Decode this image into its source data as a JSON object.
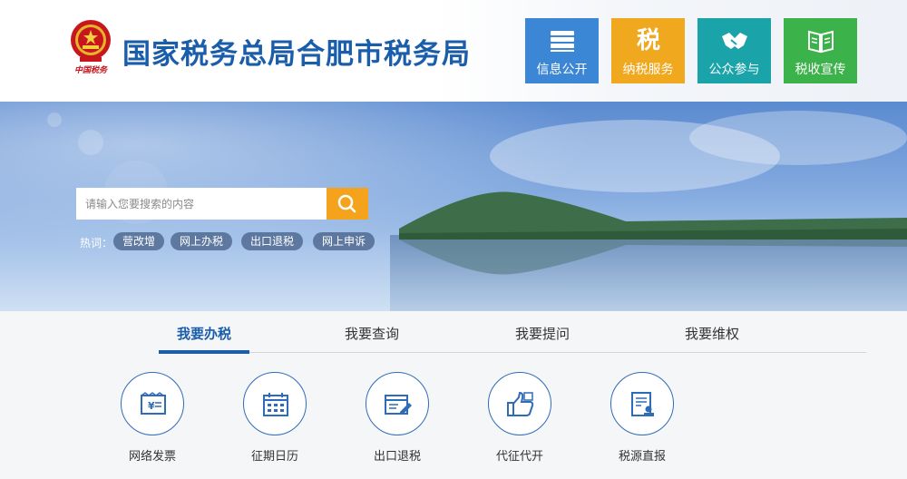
{
  "header": {
    "emblem_caption": "中国税务",
    "site_title": "国家税务总局合肥市税务局",
    "nav": [
      {
        "label": "信息公开",
        "icon": "books-icon",
        "color": "#3c86d6"
      },
      {
        "label": "纳税服务",
        "icon": "tax-character-icon",
        "glyph": "税",
        "color": "#f0a81e"
      },
      {
        "label": "公众参与",
        "icon": "handshake-icon",
        "color": "#1aa3a8"
      },
      {
        "label": "税收宣传",
        "icon": "open-book-icon",
        "color": "#3bb24a"
      }
    ]
  },
  "search": {
    "placeholder": "请输入您要搜索的内容",
    "button_icon": "search-icon",
    "hot_label": "热词：",
    "hot_terms": [
      "营改增",
      "网上办税",
      "出口退税",
      "网上申诉"
    ]
  },
  "tabs": [
    "我要办税",
    "我要查询",
    "我要提问",
    "我要维权"
  ],
  "active_tab": "我要办税",
  "services": [
    {
      "label": "网络发票",
      "icon": "invoice-icon"
    },
    {
      "label": "征期日历",
      "icon": "calendar-icon"
    },
    {
      "label": "出口退税",
      "icon": "form-edit-icon"
    },
    {
      "label": "代征代开",
      "icon": "thumbs-up-icon"
    },
    {
      "label": "税源直报",
      "icon": "report-stamp-icon"
    }
  ],
  "colors": {
    "brand_blue": "#1a5dab",
    "search_button": "#f5a21c"
  }
}
